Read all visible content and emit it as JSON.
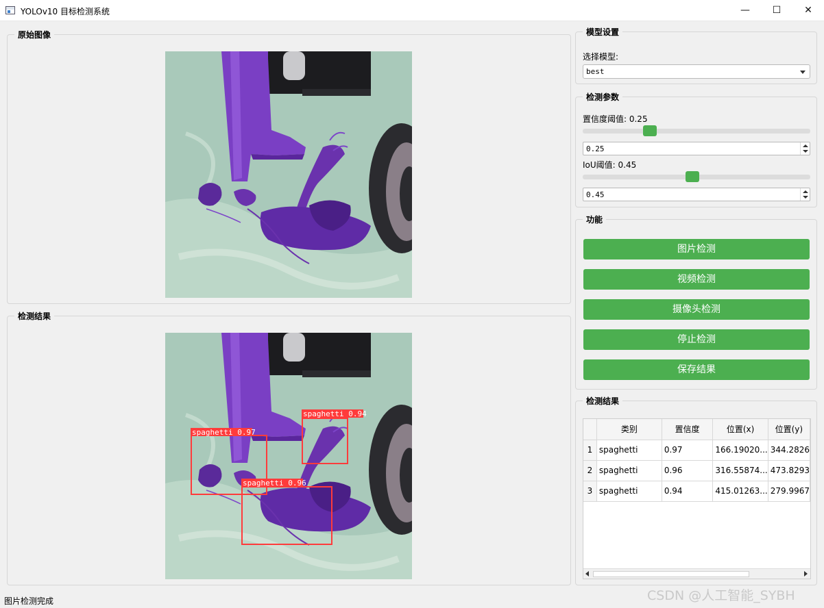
{
  "window": {
    "title": "YOLOv10 目标检测系统",
    "minimize_glyph": "—",
    "maximize_glyph": "☐",
    "close_glyph": "✕"
  },
  "original": {
    "title": "原始图像"
  },
  "result_image": {
    "title": "检测结果",
    "detections": [
      {
        "label": "spaghetti 0.97"
      },
      {
        "label": "spaghetti 0.94"
      },
      {
        "label": "spaghetti 0.96"
      }
    ]
  },
  "model_settings": {
    "title": "模型设置",
    "select_label": "选择模型:",
    "selected_model": "best"
  },
  "params": {
    "title": "检测参数",
    "conf_label": "置信度阈值: 0.25",
    "conf_value": "0.25",
    "conf_level": 0.25,
    "iou_label": "IoU阈值: 0.45",
    "iou_value": "0.45",
    "iou_level": 0.45
  },
  "functions": {
    "title": "功能",
    "image_detect": "图片检测",
    "video_detect": "视频检测",
    "camera_detect": "摄像头检测",
    "stop_detect": "停止检测",
    "save_results": "保存结果"
  },
  "results_table": {
    "title": "检测结果",
    "columns": [
      "类别",
      "置信度",
      "位置(x)",
      "位置(y)"
    ],
    "rows": [
      {
        "index": "1",
        "cls": "spaghetti",
        "conf": "0.97",
        "x": "166.19020...",
        "y": "344.2826"
      },
      {
        "index": "2",
        "cls": "spaghetti",
        "conf": "0.96",
        "x": "316.55874...",
        "y": "473.8293"
      },
      {
        "index": "3",
        "cls": "spaghetti",
        "conf": "0.94",
        "x": "415.01263...",
        "y": "279.9967"
      }
    ]
  },
  "status_text": "图片检测完成",
  "watermark": "CSDN @人工智能_SYBH",
  "colors": {
    "accent_green": "#4caf50",
    "box_red": "#ff3b3b",
    "object_purple": "#6a2fb0"
  }
}
